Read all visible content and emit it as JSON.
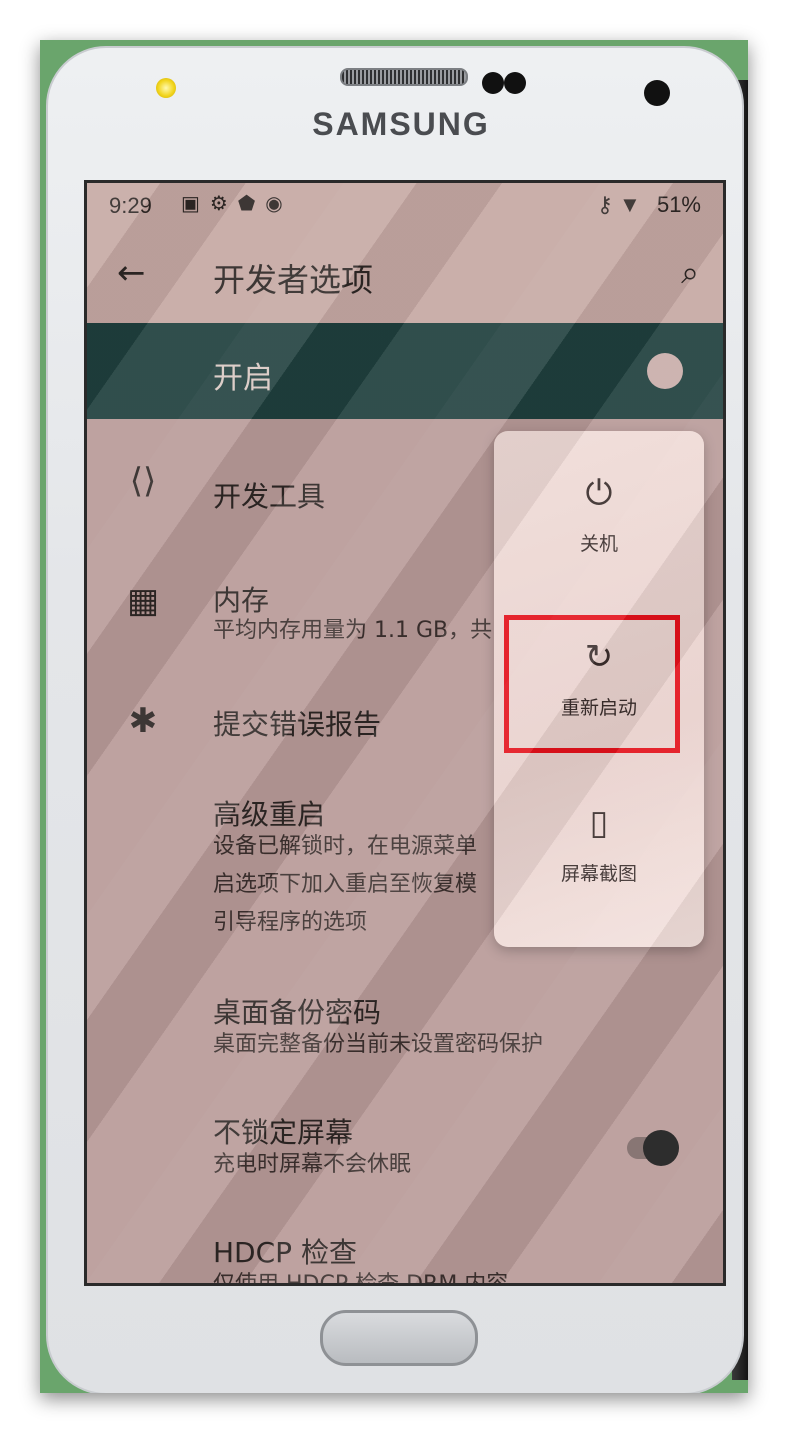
{
  "device": {
    "brand": "SAMSUNG"
  },
  "status_bar": {
    "time": "9:29",
    "left_icons": "▣⚙⬟◉",
    "right_icons": "⚷ ▼",
    "battery": "51%"
  },
  "app_bar": {
    "back_icon": "←",
    "title": "开发者选项",
    "search_icon": "⌕"
  },
  "master_switch": {
    "label": "开启",
    "state": "on"
  },
  "settings_items": [
    {
      "icon": "developer-tools-icon",
      "glyph": "⟨⟩",
      "title": "开发工具",
      "summary_lines": []
    },
    {
      "icon": "memory-chip-icon",
      "glyph": "▦",
      "title": "内存",
      "summary_lines": [
        "平均内存用量为 1.1 GB，共"
      ]
    },
    {
      "icon": "bug-icon",
      "glyph": "✱",
      "title": "提交错误报告",
      "summary_lines": []
    },
    {
      "icon": "",
      "glyph": "",
      "title": "高级重启",
      "summary_lines": [
        "设备已解锁时，在电源菜单",
        "启选项下加入重启至恢复模",
        "引导程序的选项"
      ]
    },
    {
      "icon": "",
      "glyph": "",
      "title": "桌面备份密码",
      "summary_lines": [
        "桌面完整备份当前未设置密码保护"
      ]
    },
    {
      "icon": "",
      "glyph": "",
      "title": "不锁定屏幕",
      "summary_lines": [
        "充电时屏幕不会休眠"
      ],
      "toggle": "on"
    },
    {
      "icon": "",
      "glyph": "",
      "title": "HDCP 检查",
      "summary_lines": [
        "仅使用 HDCP 检查 DRM 内容"
      ]
    }
  ],
  "power_menu": {
    "items": [
      {
        "icon": "power-icon",
        "glyph": "⏻",
        "label": "关机"
      },
      {
        "icon": "restart-icon",
        "glyph": "↻",
        "label": "重新启动",
        "highlighted": true
      },
      {
        "icon": "screenshot-icon",
        "glyph": "▯",
        "label": "屏幕截图"
      }
    ]
  },
  "colors": {
    "highlight": "#e3111b",
    "master_bar": "#1f3f3d",
    "screen_tint": "#c5a8a3"
  }
}
